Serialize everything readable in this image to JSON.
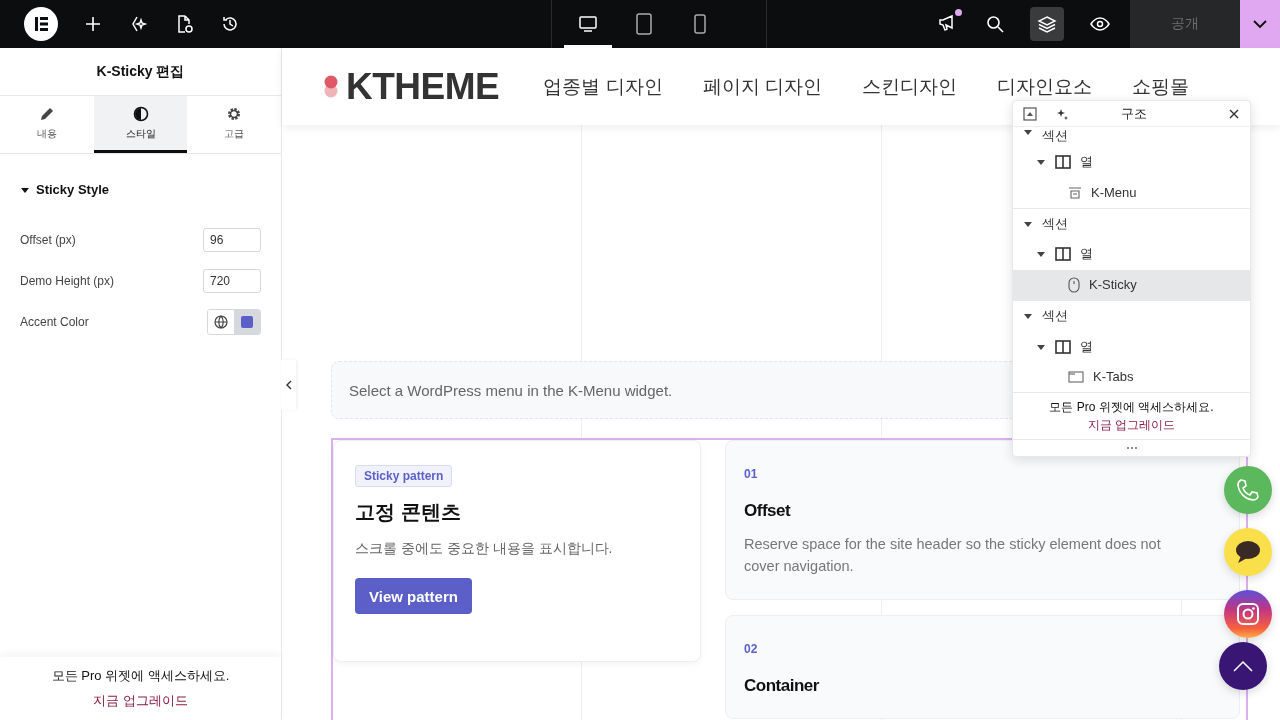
{
  "topbar": {
    "devices": [
      {
        "kind": "desktop",
        "selected": true
      },
      {
        "kind": "tablet",
        "selected": false
      },
      {
        "kind": "mobile",
        "selected": false
      }
    ],
    "notification": {
      "unread": true
    },
    "structure_toggle": {
      "selected": true
    },
    "publish": {
      "label": "공개",
      "disabled": true
    }
  },
  "panel": {
    "title": "K-Sticky 편집",
    "tabs": [
      {
        "kind": "content",
        "label": "내용",
        "selected": false
      },
      {
        "kind": "style",
        "label": "스타일",
        "selected": true
      },
      {
        "kind": "advanced",
        "label": "고급",
        "selected": false
      }
    ],
    "section": {
      "title": "Sticky Style",
      "expanded": true
    },
    "fields": [
      {
        "kind": "number",
        "label": "Offset (px)",
        "value": "96"
      },
      {
        "kind": "number",
        "label": "Demo Height (px)",
        "value": "720"
      },
      {
        "kind": "color",
        "label": "Accent Color",
        "color": "#5b5fc7"
      }
    ],
    "promo": {
      "text": "모든 Pro 위젯에 액세스하세요.",
      "link": "지금 업그레이드"
    }
  },
  "site": {
    "logo": "KTHEME",
    "nav": [
      "업종별 디자인",
      "페이지 디자인",
      "스킨디자인",
      "디자인요소",
      "쇼핑몰"
    ],
    "notice": "Select a WordPress menu in the K-Menu widget.",
    "sticky_card": {
      "badge": "Sticky pattern",
      "title": "고정 콘텐츠",
      "text": "스크롤 중에도 중요한 내용을 표시합니다.",
      "button": "View pattern"
    },
    "steps": [
      {
        "number": "01",
        "title": "Offset",
        "text": "Reserve space for the site header so the sticky element does not cover navigation."
      },
      {
        "number": "02",
        "title": "Container"
      }
    ],
    "floating": [
      {
        "kind": "phone"
      },
      {
        "kind": "chat"
      },
      {
        "kind": "instagram"
      },
      {
        "kind": "top"
      }
    ]
  },
  "structure": {
    "title": "구조",
    "tree": [
      {
        "label": "섹션",
        "expanded": true,
        "selected": false,
        "children": [
          {
            "kind": "column",
            "label": "열",
            "expanded": true,
            "selected": false,
            "children": [
              {
                "kind": "menu",
                "label": "K-Menu",
                "selected": false
              }
            ]
          }
        ]
      },
      {
        "label": "섹션",
        "expanded": true,
        "selected": false,
        "children": [
          {
            "kind": "column",
            "label": "열",
            "expanded": true,
            "selected": false,
            "children": [
              {
                "kind": "sticky",
                "label": "K-Sticky",
                "selected": true
              }
            ]
          }
        ]
      },
      {
        "label": "섹션",
        "expanded": true,
        "selected": false,
        "children": [
          {
            "kind": "column",
            "label": "열",
            "expanded": true,
            "selected": false,
            "children": [
              {
                "kind": "tabs",
                "label": "K-Tabs",
                "selected": false
              }
            ]
          }
        ]
      }
    ],
    "promo": {
      "text": "모든 Pro 위젯에 액세스하세요.",
      "link": "지금 업그레이드"
    }
  }
}
